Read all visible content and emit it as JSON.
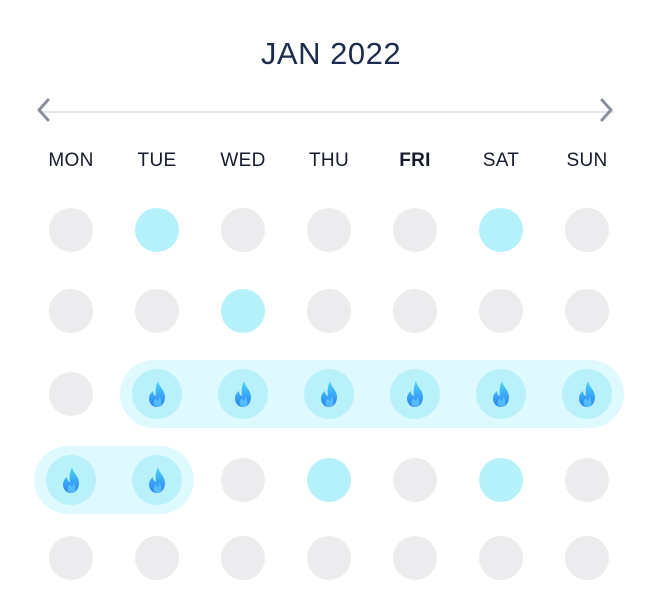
{
  "header": {
    "title": "JAN 2022"
  },
  "navigation": {
    "prev_icon": "chevron-left-icon",
    "next_icon": "chevron-right-icon"
  },
  "weekdays": [
    "MON",
    "TUE",
    "WED",
    "THU",
    "FRI",
    "SAT",
    "SUN"
  ],
  "highlighted_weekday": "FRI",
  "legend_states": {
    "0": "empty",
    "1": "active",
    "2": "streak"
  },
  "calendar": {
    "rows": [
      [
        0,
        1,
        0,
        0,
        0,
        1,
        0
      ],
      [
        0,
        0,
        1,
        0,
        0,
        0,
        0
      ],
      [
        0,
        2,
        2,
        2,
        2,
        2,
        2
      ],
      [
        2,
        2,
        0,
        1,
        0,
        1,
        0
      ],
      [
        0,
        0,
        0,
        0,
        0,
        0,
        0
      ]
    ],
    "streak_icon": "flame-icon"
  },
  "colors": {
    "title": "#1d2b4f",
    "empty_day": "#ececee",
    "active_day": "#b4f1fb",
    "streak_band": "#defafe",
    "flame_top": "#4dd6fb",
    "flame_bottom": "#2d7ff5"
  }
}
